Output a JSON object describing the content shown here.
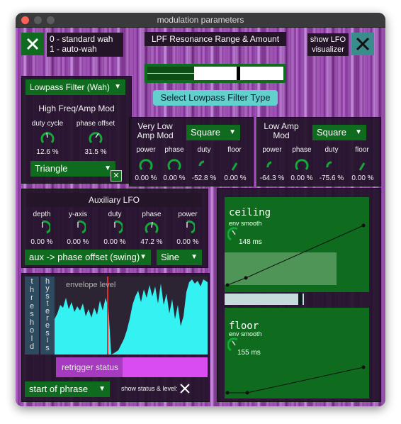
{
  "window": {
    "title": "modulation parameters"
  },
  "mode_toggle": {
    "line1": "0 - standard wah",
    "line2": "1 - auto-wah"
  },
  "lpf": {
    "title": "LPF Resonance Range & Amount",
    "select_button": "Select Lowpass Filter Type"
  },
  "lfo_toggle": {
    "line1": "show LFO",
    "line2": "visualizer"
  },
  "filter_panel": {
    "filter_select": "Lowpass Filter (Wah)",
    "title": "High Freq/Amp Mod",
    "knobs": [
      {
        "label": "duty cycle",
        "value": "12.6 %"
      },
      {
        "label": "phase offset",
        "value": "31.5 %"
      }
    ],
    "wave_select": "Triangle"
  },
  "vlow_panel": {
    "title_line1": "Very Low",
    "title_line2": "Amp Mod",
    "wave_select": "Square",
    "knobs": [
      {
        "label": "power",
        "value": "0.00 %"
      },
      {
        "label": "phase",
        "value": "0.00 %"
      },
      {
        "label": "duty",
        "value": "-52.8 %"
      },
      {
        "label": "floor",
        "value": "0.00 %"
      }
    ]
  },
  "low_panel": {
    "title_line1": "Low Amp",
    "title_line2": "Mod",
    "wave_select": "Square",
    "knobs": [
      {
        "label": "power",
        "value": "-64.3 %"
      },
      {
        "label": "phase",
        "value": "0.00 %"
      },
      {
        "label": "duty",
        "value": "-75.6 %"
      },
      {
        "label": "floor",
        "value": "0.00 %"
      }
    ]
  },
  "aux_panel": {
    "title": "Auxiliary LFO",
    "knobs": [
      {
        "label": "depth",
        "value": "0.00 %"
      },
      {
        "label": "y-axis",
        "value": "0.00 %"
      },
      {
        "label": "duty",
        "value": "0.00 %"
      },
      {
        "label": "phase",
        "value": "47.2 %"
      },
      {
        "label": "power",
        "value": "0.00 %"
      }
    ],
    "route_select": "aux -> phase offset (swing)",
    "wave_select": "Sine"
  },
  "envelope_panel": {
    "threshold_label": [
      "t",
      "h",
      "r",
      "e",
      "s",
      "h",
      "o",
      "l",
      "d"
    ],
    "hysteresis_label": [
      "h",
      "y",
      "s",
      "t",
      "e",
      "r",
      "e",
      "s",
      "i",
      "s"
    ],
    "envelope_label": "envelope level",
    "retrigger_label": "retrigger status",
    "trigger_select": "start of phrase",
    "show_status_label": "show status & level:"
  },
  "ceiling_panel": {
    "title": "ceiling",
    "sublabel": "env smooth",
    "value": "148 ms"
  },
  "floor_panel": {
    "title": "floor",
    "sublabel": "env smooth",
    "value": "155 ms"
  },
  "colors": {
    "green": "#0f6b1d",
    "cyan": "#35f2f2",
    "magenta": "#d94cf0",
    "teal_button": "#62d0cc"
  }
}
